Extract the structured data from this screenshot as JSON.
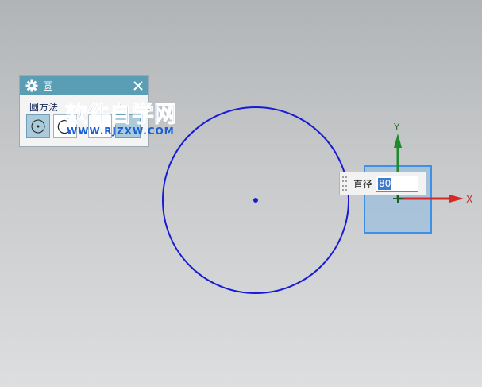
{
  "dialog": {
    "title": "圆",
    "method_label": "圆方法",
    "icons": {
      "settings": "gear-icon",
      "close": "close-icon",
      "method_center": "circle-center-icon",
      "method_other": "circle-three-point-icon"
    }
  },
  "watermark": {
    "title": "软件自学网",
    "url": "WWW.RJZXW.COM"
  },
  "diameter": {
    "label": "直径",
    "value": "80"
  },
  "axes": {
    "x_label": "X",
    "y_label": "Y"
  },
  "colors": {
    "circle": "#1a1ad6",
    "x_axis": "#d42a2a",
    "y_axis": "#1f8a2c",
    "title_bar": "#5a9eb5",
    "accent": "#3d90e8"
  }
}
